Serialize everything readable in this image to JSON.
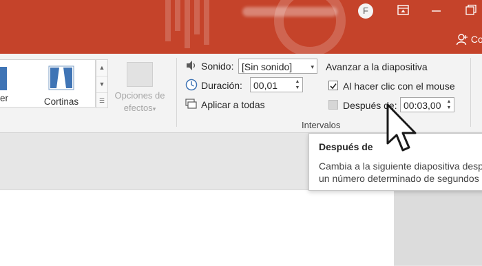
{
  "titlebar": {
    "avatar_initial": "F",
    "share_label": "Co",
    "colors": {
      "background": "#c5432a"
    }
  },
  "ribbon": {
    "transitions": {
      "items": [
        {
          "label": "er"
        },
        {
          "label": "Cortinas"
        }
      ],
      "effect_options": {
        "line1": "Opciones de",
        "line2": "efectos",
        "arrow": "▾"
      }
    },
    "timing": {
      "sound": {
        "label": "Sonido:",
        "value": "[Sin sonido]"
      },
      "duration": {
        "label": "Duración:",
        "value": "00,01"
      },
      "apply_all": {
        "label": "Aplicar a todas"
      },
      "advance": {
        "heading": "Avanzar a la diapositiva",
        "on_click": {
          "label": "Al hacer clic con el mouse",
          "checked": true
        },
        "after": {
          "label": "Después de:",
          "value": "00:03,00",
          "checked": false
        }
      },
      "group_label": "Intervalos"
    }
  },
  "tooltip": {
    "title": "Después de",
    "line1": "Cambia a la siguiente diapositiva desp",
    "line2": "un número determinado de segundos"
  },
  "icons": {
    "sound": "speaker-icon",
    "duration": "clock-icon",
    "apply_all": "apply-all-icon",
    "gallery_transition": "curtains-transition-icon",
    "cursor": "mouse-pointer-icon"
  }
}
